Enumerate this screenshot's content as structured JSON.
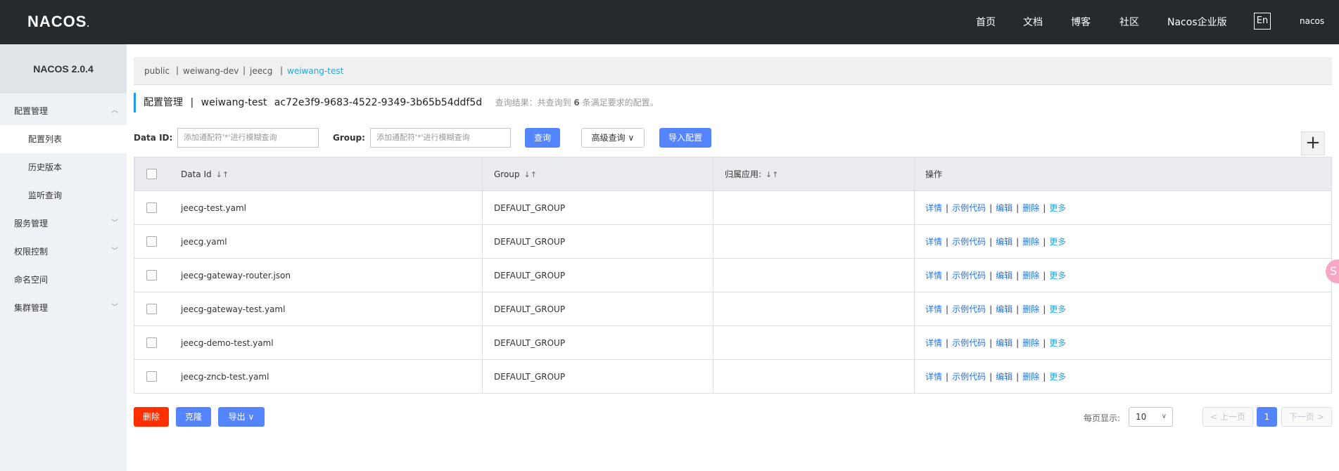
{
  "header": {
    "logo": "NACOS",
    "nav": [
      "首页",
      "文档",
      "博客",
      "社区",
      "Nacos企业版"
    ],
    "lang": "En",
    "user": "nacos"
  },
  "sidebar": {
    "version": "NACOS 2.0.4",
    "items": [
      {
        "label": "配置管理",
        "expanded": true
      },
      {
        "label": "配置列表"
      },
      {
        "label": "历史版本"
      },
      {
        "label": "监听查询"
      },
      {
        "label": "服务管理"
      },
      {
        "label": "权限控制"
      },
      {
        "label": "命名空间"
      },
      {
        "label": "集群管理"
      }
    ]
  },
  "namespaces": [
    "public",
    "weiwang-dev",
    "jeecg",
    "weiwang-test"
  ],
  "active_namespace": "weiwang-test",
  "title": {
    "section": "配置管理",
    "namespace": "weiwang-test",
    "namespace_id": "ac72e3f9-9683-4522-9349-3b65b54ddf5d",
    "result_prefix": "查询结果：共查询到",
    "result_count": "6",
    "result_suffix": "条满足要求的配置。"
  },
  "filters": {
    "dataid_label": "Data ID:",
    "dataid_placeholder": "添加通配符'*'进行模糊查询",
    "group_label": "Group:",
    "group_placeholder": "添加通配符'*'进行模糊查询",
    "query_button": "查询",
    "advanced_button": "高级查询",
    "import_button": "导入配置"
  },
  "table": {
    "columns": [
      "Data Id",
      "Group",
      "归属应用:",
      "操作"
    ],
    "rows": [
      {
        "data_id": "jeecg-test.yaml",
        "group": "DEFAULT_GROUP",
        "app": ""
      },
      {
        "data_id": "jeecg.yaml",
        "group": "DEFAULT_GROUP",
        "app": ""
      },
      {
        "data_id": "jeecg-gateway-router.json",
        "group": "DEFAULT_GROUP",
        "app": ""
      },
      {
        "data_id": "jeecg-gateway-test.yaml",
        "group": "DEFAULT_GROUP",
        "app": ""
      },
      {
        "data_id": "jeecg-demo-test.yaml",
        "group": "DEFAULT_GROUP",
        "app": ""
      },
      {
        "data_id": "jeecg-zncb-test.yaml",
        "group": "DEFAULT_GROUP",
        "app": ""
      }
    ],
    "actions": [
      "详情",
      "示例代码",
      "编辑",
      "删除",
      "更多"
    ]
  },
  "footer": {
    "delete_button": "删除",
    "clone_button": "克隆",
    "export_button": "导出",
    "page_size_label": "每页显示:",
    "page_size": "10",
    "prev": "上一页",
    "current_page": "1",
    "next": "下一页"
  },
  "colors": {
    "header_bg": "#252a2f",
    "primary": "#5584ff",
    "danger": "#ff3000",
    "link": "#2073d7",
    "accent": "#23a6d5"
  }
}
